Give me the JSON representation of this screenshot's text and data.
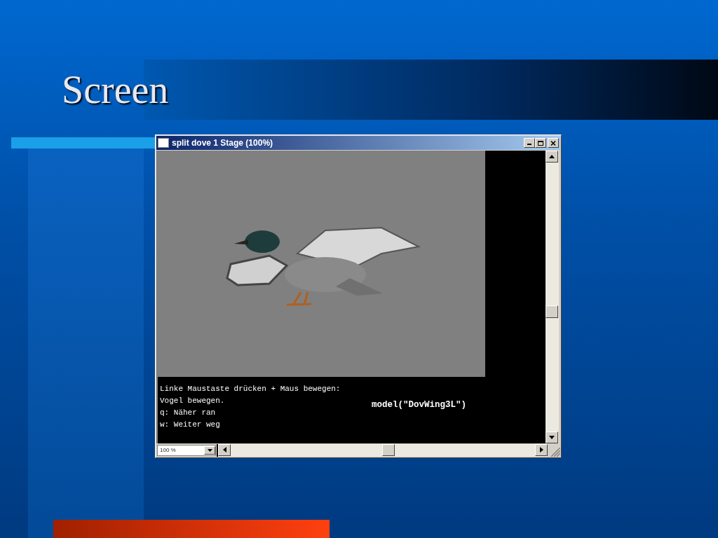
{
  "slide": {
    "title": "Screen"
  },
  "window": {
    "title": "split dove 1 Stage (100%)",
    "help_lines": [
      "Linke Maustaste drücken + Maus bewegen:",
      "Vogel bewegen.",
      "q: Näher ran",
      "w: Weiter weg"
    ],
    "model_label": "model(\"DovWing3L\")",
    "zoom": {
      "value": "100 %"
    }
  }
}
